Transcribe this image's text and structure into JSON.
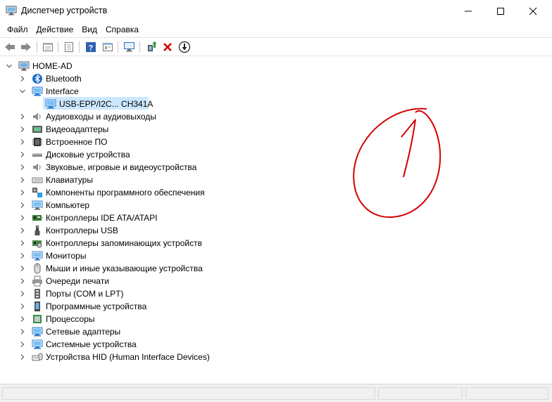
{
  "window": {
    "title": "Диспетчер устройств",
    "buttons": {
      "minimize": "—",
      "maximize": "☐",
      "close": "✕"
    }
  },
  "menu": {
    "items": [
      "Файл",
      "Действие",
      "Вид",
      "Справка"
    ]
  },
  "toolbar": {
    "icons": [
      "back-icon",
      "forward-icon",
      "properties-icon",
      "view-icon",
      "help-icon",
      "resources-icon",
      "scan-hardware-icon",
      "update-driver-icon",
      "uninstall-icon",
      "disable-icon"
    ]
  },
  "tree": {
    "root": "HOME-AD",
    "items": [
      {
        "label": "Bluetooth",
        "icon": "bluetooth-icon",
        "expanded": false
      },
      {
        "label": "Interface",
        "icon": "network-adapter-icon",
        "expanded": true
      },
      {
        "label": "USB-EPP/I2C... CH341A",
        "icon": "network-adapter-icon",
        "child": true,
        "selected": true
      },
      {
        "label": "Аудиовходы и аудиовыходы",
        "icon": "speaker-icon",
        "expanded": false
      },
      {
        "label": "Видеоадаптеры",
        "icon": "display-adapter-icon",
        "expanded": false
      },
      {
        "label": "Встроенное ПО",
        "icon": "firmware-icon",
        "expanded": false
      },
      {
        "label": "Дисковые устройства",
        "icon": "disk-icon",
        "expanded": false
      },
      {
        "label": "Звуковые, игровые и видеоустройства",
        "icon": "speaker-icon",
        "expanded": false
      },
      {
        "label": "Клавиатуры",
        "icon": "keyboard-icon",
        "expanded": false
      },
      {
        "label": "Компоненты программного обеспечения",
        "icon": "software-component-icon",
        "expanded": false
      },
      {
        "label": "Компьютер",
        "icon": "computer-icon",
        "expanded": false
      },
      {
        "label": "Контроллеры IDE ATA/ATAPI",
        "icon": "ide-controller-icon",
        "expanded": false
      },
      {
        "label": "Контроллеры USB",
        "icon": "usb-icon",
        "expanded": false
      },
      {
        "label": "Контроллеры запоминающих устройств",
        "icon": "storage-controller-icon",
        "expanded": false
      },
      {
        "label": "Мониторы",
        "icon": "monitor-icon",
        "expanded": false
      },
      {
        "label": "Мыши и иные указывающие устройства",
        "icon": "mouse-icon",
        "expanded": false
      },
      {
        "label": "Очереди печати",
        "icon": "printer-icon",
        "expanded": false
      },
      {
        "label": "Порты (COM и LPT)",
        "icon": "port-icon",
        "expanded": false
      },
      {
        "label": "Программные устройства",
        "icon": "software-device-icon",
        "expanded": false
      },
      {
        "label": "Процессоры",
        "icon": "processor-icon",
        "expanded": false
      },
      {
        "label": "Сетевые адаптеры",
        "icon": "network-adapter-icon",
        "expanded": false
      },
      {
        "label": "Системные устройства",
        "icon": "system-device-icon",
        "expanded": false
      },
      {
        "label": "Устройства HID (Human Interface Devices)",
        "icon": "hid-icon",
        "expanded": false
      }
    ]
  },
  "annotation": {
    "color": "#d40000"
  },
  "colors": {
    "selection": "#cce8ff",
    "accent": "#2a7fd4",
    "uninstall": "#d40000"
  }
}
